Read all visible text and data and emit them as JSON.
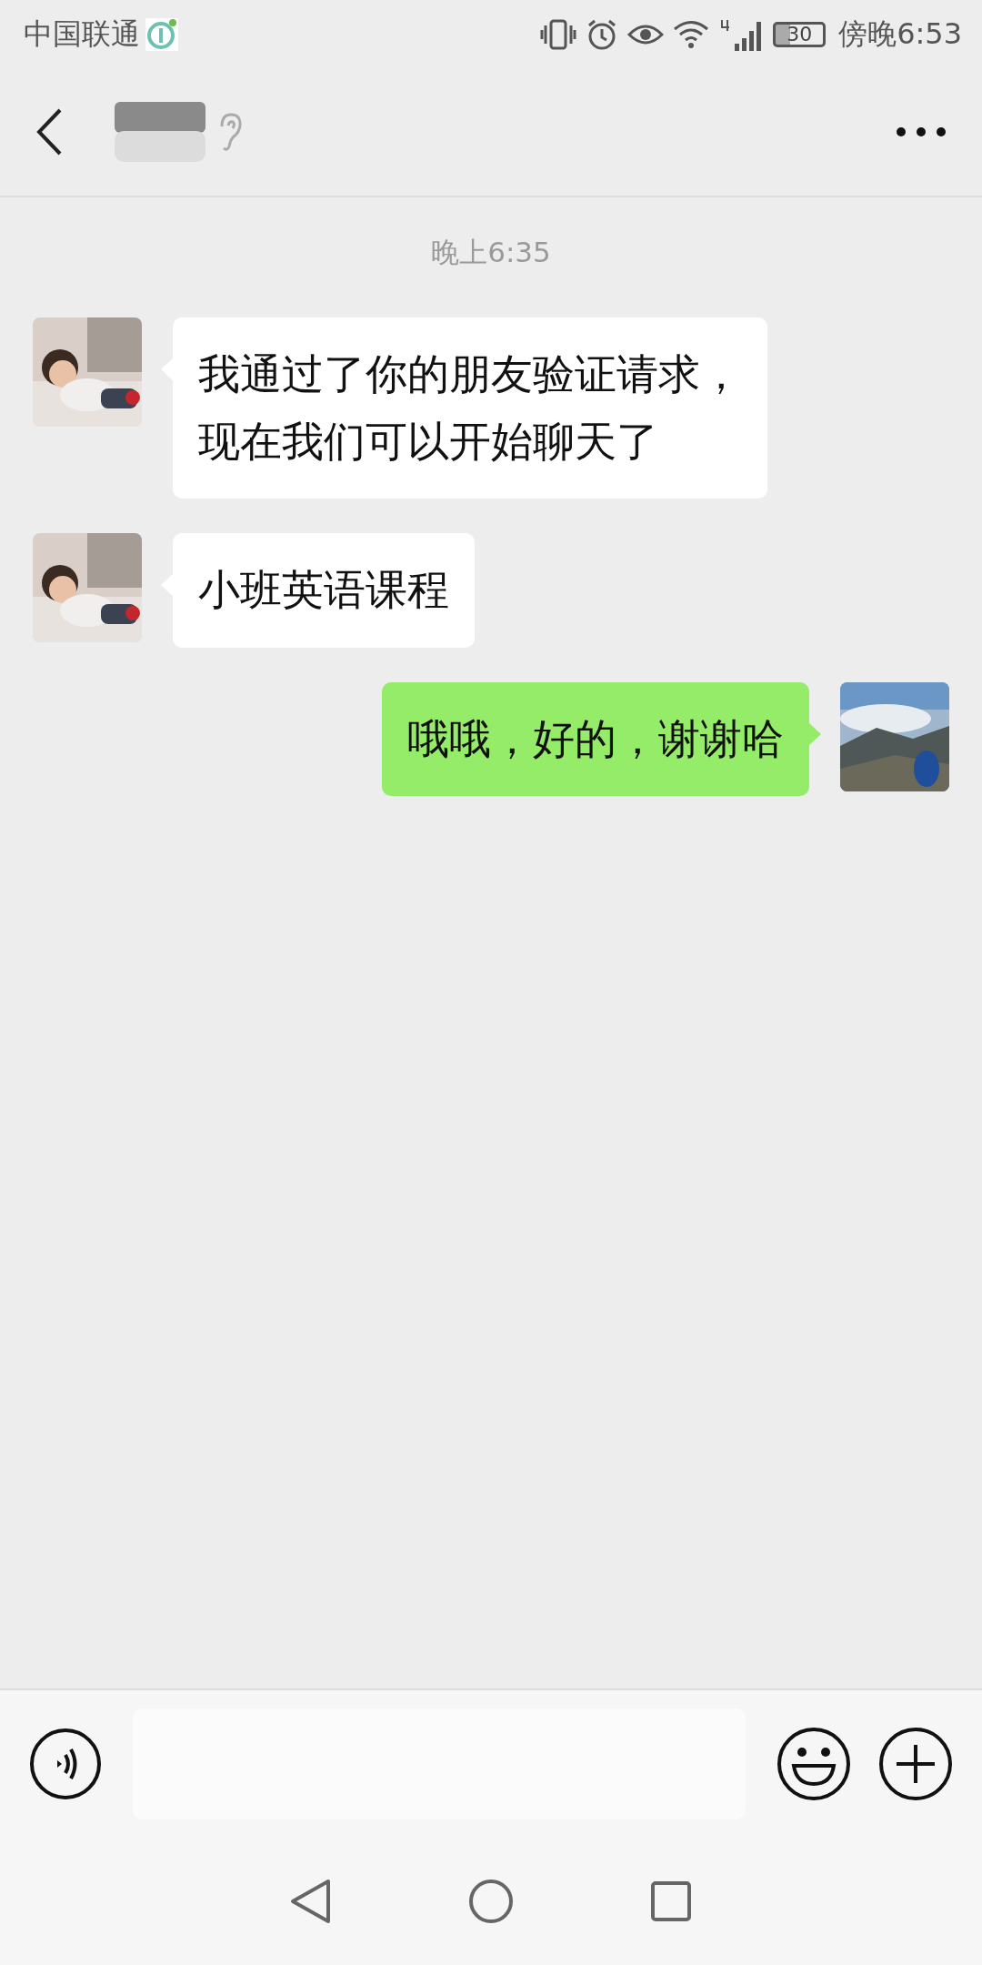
{
  "status_bar": {
    "carrier": "中国联通",
    "battery": "30",
    "time": "傍晚6:53"
  },
  "timestamp": "晚上6:35",
  "messages": [
    {
      "kind": "incoming",
      "lines": [
        "我通过了你的朋友验证请求，",
        "现在我们可以开始聊天了"
      ]
    },
    {
      "kind": "incoming",
      "lines": [
        "小班英语课程"
      ]
    },
    {
      "kind": "outgoing",
      "lines": [
        "哦哦，好的，谢谢哈"
      ]
    }
  ]
}
